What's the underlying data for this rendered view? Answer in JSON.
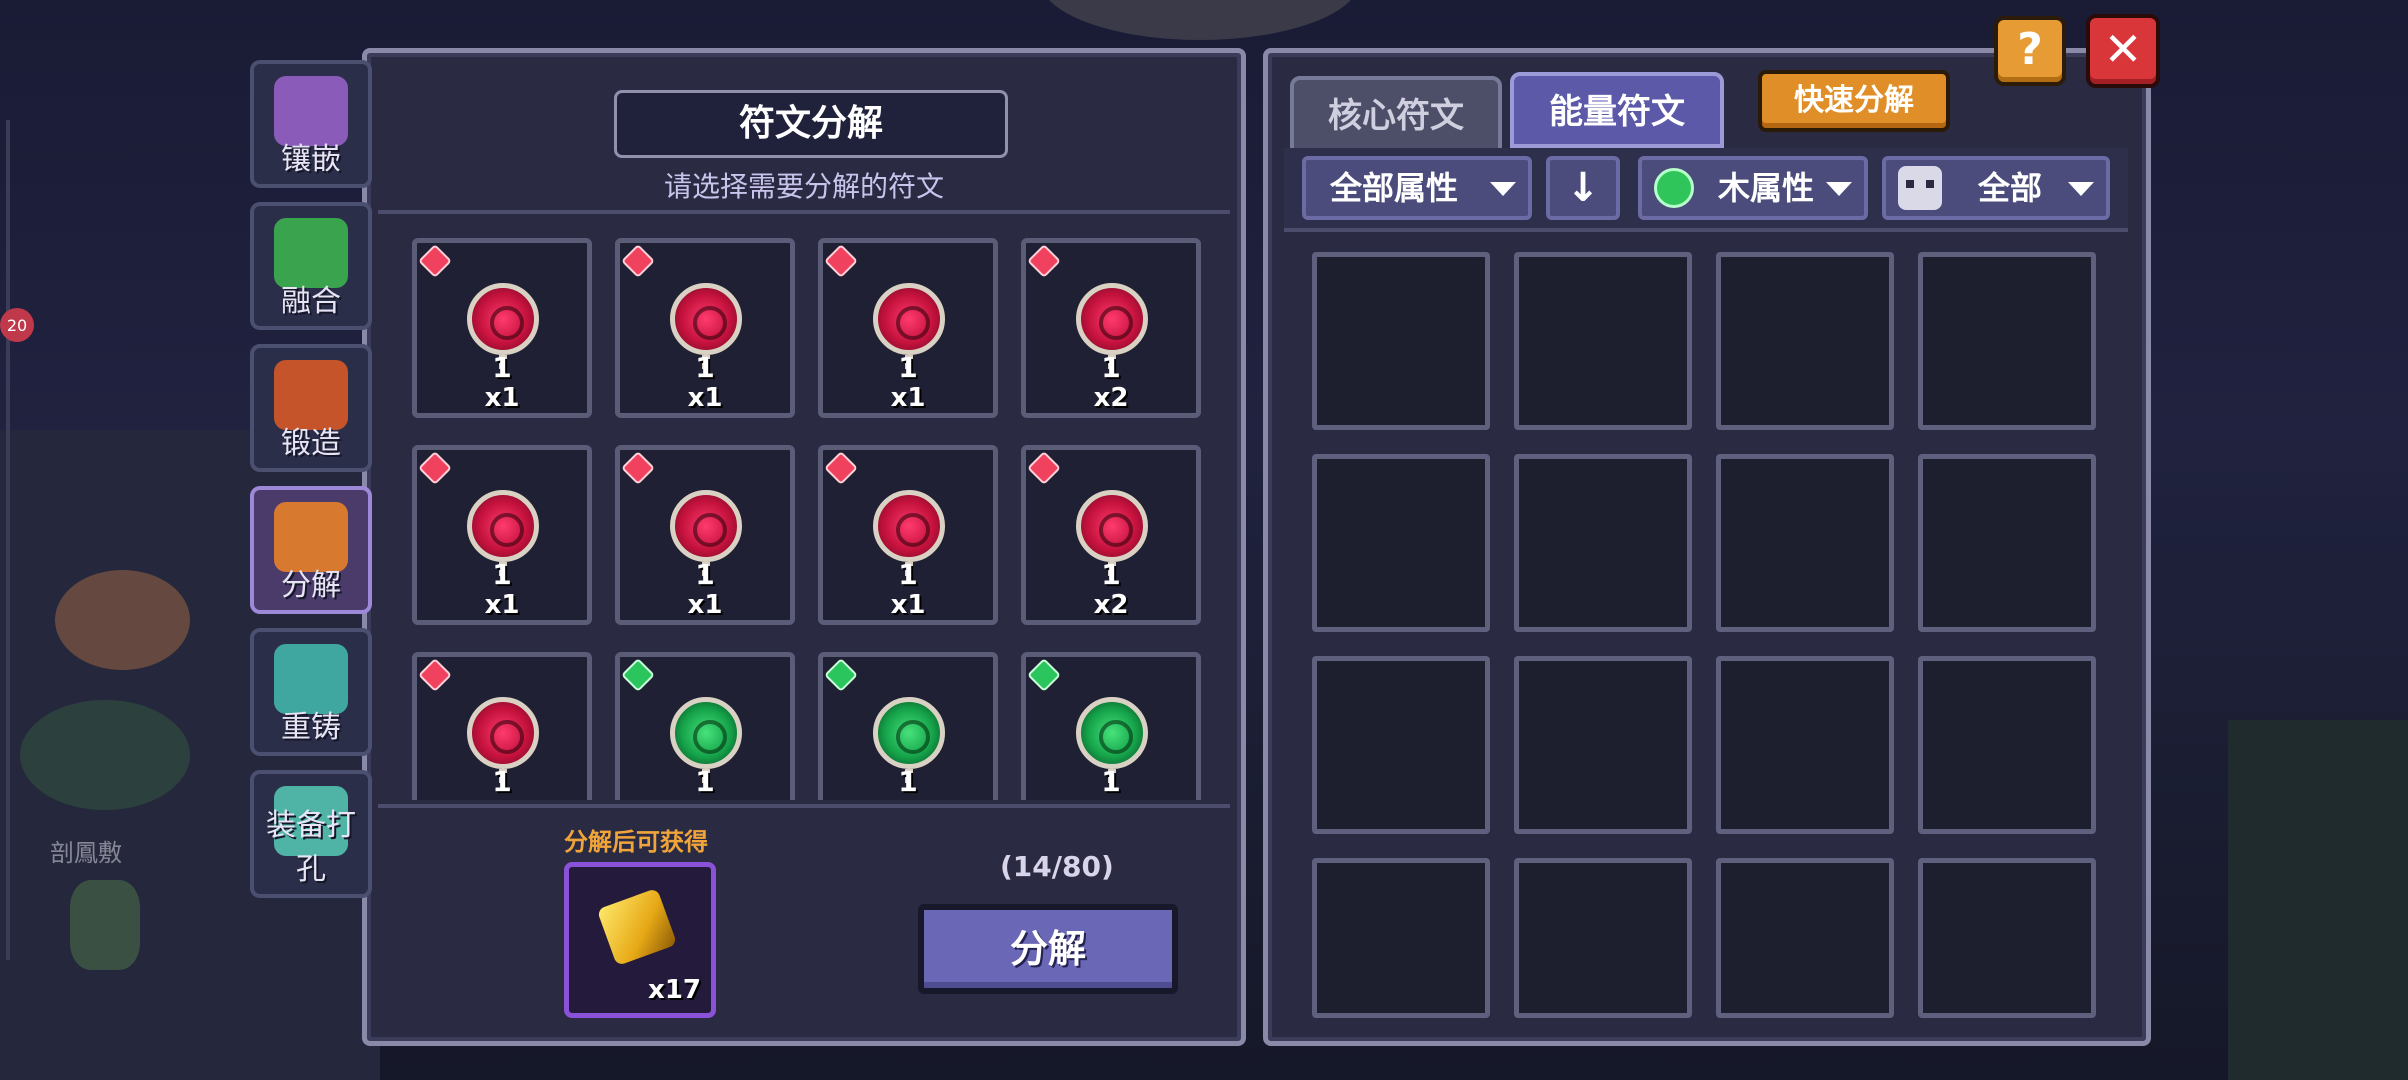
{
  "background": {
    "badge_count": "20",
    "npc_name": "剖鳳敷"
  },
  "side_tabs": [
    {
      "label": "镶嵌",
      "active": false,
      "icon": "inlay-icon",
      "color": "#8a5bb8"
    },
    {
      "label": "融合",
      "active": false,
      "icon": "fusion-icon",
      "color": "#3aa34e"
    },
    {
      "label": "锻造",
      "active": false,
      "icon": "forge-icon",
      "color": "#c5542a"
    },
    {
      "label": "分解",
      "active": true,
      "icon": "decompose-icon",
      "color": "#d77a2f"
    },
    {
      "label": "重铸",
      "active": false,
      "icon": "recast-icon",
      "color": "#3fa6a0"
    },
    {
      "label": "装备打孔",
      "active": false,
      "icon": "socket-icon",
      "color": "#4fb3a6"
    }
  ],
  "left_panel": {
    "title": "符文分解",
    "subtitle": "请选择需要分解的符文",
    "runes": [
      {
        "element": "red",
        "level": "1",
        "count": "x1"
      },
      {
        "element": "red",
        "level": "1",
        "count": "x1"
      },
      {
        "element": "red",
        "level": "1",
        "count": "x1"
      },
      {
        "element": "red",
        "level": "1",
        "count": "x2"
      },
      {
        "element": "red",
        "level": "1",
        "count": "x1"
      },
      {
        "element": "red",
        "level": "1",
        "count": "x1"
      },
      {
        "element": "red",
        "level": "1",
        "count": "x1"
      },
      {
        "element": "red",
        "level": "1",
        "count": "x2"
      },
      {
        "element": "red",
        "level": "1",
        "count": ""
      },
      {
        "element": "green",
        "level": "1",
        "count": ""
      },
      {
        "element": "green",
        "level": "1",
        "count": ""
      },
      {
        "element": "green",
        "level": "1",
        "count": ""
      }
    ],
    "reward_label": "分解后可获得",
    "reward_qty": "x17",
    "capacity": "(14/80)",
    "decompose_button": "分解"
  },
  "right_panel": {
    "tabs": [
      {
        "label": "核心符文",
        "active": false
      },
      {
        "label": "能量符文",
        "active": true
      }
    ],
    "quick_decompose": "快速分解",
    "filters": {
      "attribute": "全部属性",
      "sort_icon": "arrow-down-icon",
      "element": "木属性",
      "category": "全部"
    },
    "empty_slots": 16
  },
  "buttons": {
    "help": "?",
    "close": "✕"
  },
  "colors": {
    "accent_purple": "#6a67b6",
    "orange": "#e08e28",
    "red": "#d9363a",
    "rune_red": "#c5123d",
    "rune_green": "#15a34a"
  }
}
